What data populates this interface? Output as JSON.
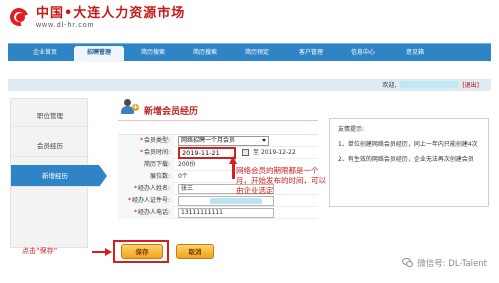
{
  "header": {
    "logo_title": "中国•大连人力资源市场",
    "logo_url": "www.dl-hr.com"
  },
  "nav": {
    "items": [
      "企业首页",
      "招聘管理",
      "简历搜索",
      "简历搜索",
      "简历预定",
      "客户管理",
      "信息中心",
      "意见箱"
    ],
    "active_index": 1
  },
  "welcome": {
    "prefix": "欢迎,",
    "logout": "[退出]"
  },
  "sidebar": {
    "items": [
      {
        "label": "职位管理"
      },
      {
        "label": "会员经历"
      },
      {
        "label": "新增经历"
      }
    ],
    "active_index": 2
  },
  "page": {
    "title": "新增会员经历"
  },
  "form": {
    "member_type_label": "会员类型:",
    "member_type_value": "网络招聘一个月会员",
    "member_time_label": "会员时间:",
    "start_date": "2019-11-21",
    "to_text": "至",
    "end_date": "2019-12-22",
    "resume_download_label": "简历下载:",
    "resume_download_value": "200份",
    "job_count_label": "展位数:",
    "job_count_value": "0个",
    "agent_name_label": "经办人姓名:",
    "agent_name_value": "张三",
    "agent_id_label": "经办人证件号:",
    "agent_id_value": "",
    "agent_phone_label": "经办人电话:",
    "agent_phone_value": "13111111111",
    "required_mark": "*"
  },
  "annotation": {
    "text": "网络会员的期限都是一个月，开始发布的时间，可以由企业选定",
    "click_hint": "点击“保存”"
  },
  "buttons": {
    "save": "保存",
    "cancel": "取消"
  },
  "tips": {
    "title": "友情提示:",
    "items": [
      "1、单位创建网络会员经历，同上一年内只能创建4次",
      "2、有生效的网络会员经历，企业无法再次创建会员"
    ]
  },
  "watermark": {
    "text": "微信号: DL-Talent"
  },
  "colors": {
    "brand_red": "#c81818",
    "nav_blue": "#2f84c6",
    "annotation_red": "#d21f1f",
    "button_orange": "#f2a21d"
  }
}
